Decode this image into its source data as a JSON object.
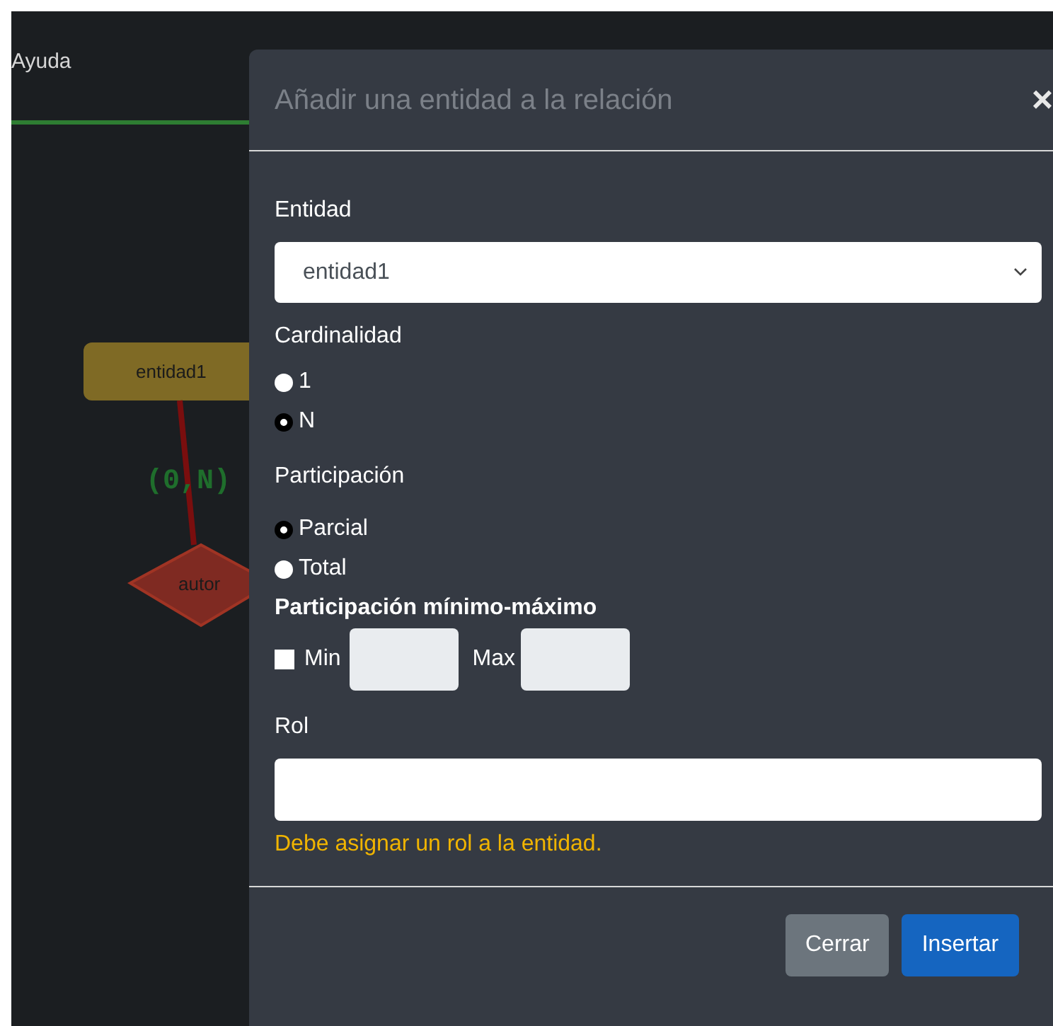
{
  "app": {
    "menu_item": "Ayuda"
  },
  "diagram": {
    "entity": "entidad1",
    "cardinality": "(0,N)",
    "relation": "autor"
  },
  "modal": {
    "title": "Añadir una entidad a la relación",
    "close": "×",
    "entity_label": "Entidad",
    "entity_value": "entidad1",
    "cardinality_label": "Cardinalidad",
    "cardinality_options": [
      {
        "label": "1",
        "selected": false
      },
      {
        "label": "N",
        "selected": true
      }
    ],
    "participation_label": "Participación",
    "participation_options": [
      {
        "label": "Parcial",
        "selected": true
      },
      {
        "label": "Total",
        "selected": false
      }
    ],
    "minmax_label": "Participación mínimo-máximo",
    "minmax": {
      "checked": false,
      "min_label": "Min",
      "max_label": "Max"
    },
    "role_label": "Rol",
    "role_warning": "Debe asignar un rol a la entidad.",
    "buttons": [
      {
        "kind": "secondary",
        "label": "Cerrar"
      },
      {
        "kind": "primary",
        "label": "Insertar"
      }
    ]
  }
}
